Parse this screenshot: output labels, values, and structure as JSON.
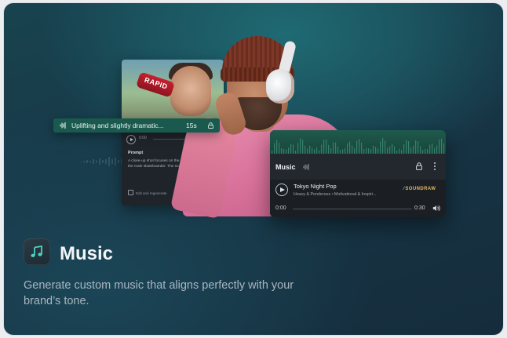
{
  "prompt_card": {
    "photo_can_text": "RAPID",
    "player_start": "0:00",
    "player_end": "",
    "label": "Prompt",
    "text": "A close-up shot focuses on the determined face of the male skateboarder. The scene.",
    "footer": "Edit and regenerate"
  },
  "prompt_pill": {
    "text": "Uplifting and slightly dramatic...",
    "duration": "15s",
    "icon": "waveform-icon",
    "lock_icon": "lock-icon"
  },
  "music_card": {
    "title": "Music",
    "track_title": "Tokyo Night Pop",
    "track_subtitle": "Heavy & Ponderous • Motivational & Inspiri...",
    "brand": "SOUNDRAW",
    "time_current": "0:00",
    "time_total": "0:30",
    "progress": 0,
    "accent_color": "#1a5a4e"
  },
  "feature": {
    "title": "Music",
    "description": "Generate custom music that aligns perfectly with your brand’s tone.",
    "icon": "music-note-icon"
  }
}
